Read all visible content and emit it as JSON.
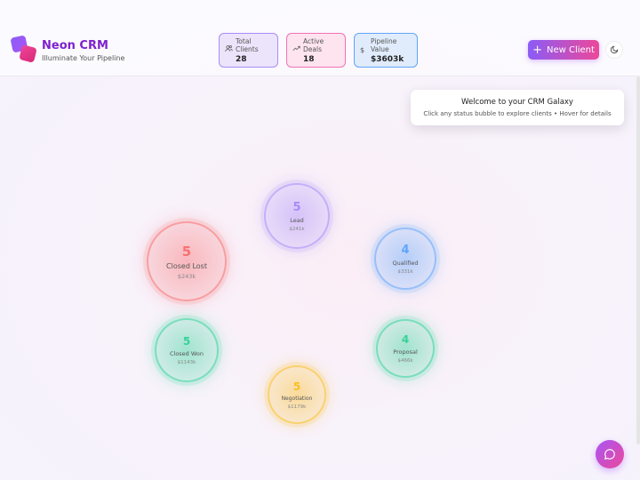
{
  "brand": {
    "name": "Neon CRM",
    "tagline": "Illuminate Your Pipeline"
  },
  "stats": [
    {
      "label_line1": "Total",
      "label_line2": "Clients",
      "value": "28",
      "icon": "users-icon"
    },
    {
      "label_line1": "Active",
      "label_line2": "Deals",
      "value": "18",
      "icon": "trend-up-icon"
    },
    {
      "label_line1": "Pipeline",
      "label_line2": "Value",
      "value": "$3603k",
      "icon": "dollar-icon"
    }
  ],
  "actions": {
    "new_client": "New Client",
    "plus": "+"
  },
  "welcome": {
    "title": "Welcome to your CRM Galaxy",
    "subtitle": "Click any status bubble to explore clients • Hover for details"
  },
  "bubbles": [
    {
      "count": "5",
      "status": "Lead",
      "value": "$241k",
      "color": "#a78bfa"
    },
    {
      "count": "4",
      "status": "Qualified",
      "value": "$331k",
      "color": "#60a5fa"
    },
    {
      "count": "5",
      "status": "Closed Lost",
      "value": "$243k",
      "color": "#f87171"
    },
    {
      "count": "5",
      "status": "Closed Won",
      "value": "$1143k",
      "color": "#34d399"
    },
    {
      "count": "4",
      "status": "Proposal",
      "value": "$466k",
      "color": "#34d399"
    },
    {
      "count": "5",
      "status": "Negotiation",
      "value": "$1179k",
      "color": "#fbbf24"
    }
  ]
}
